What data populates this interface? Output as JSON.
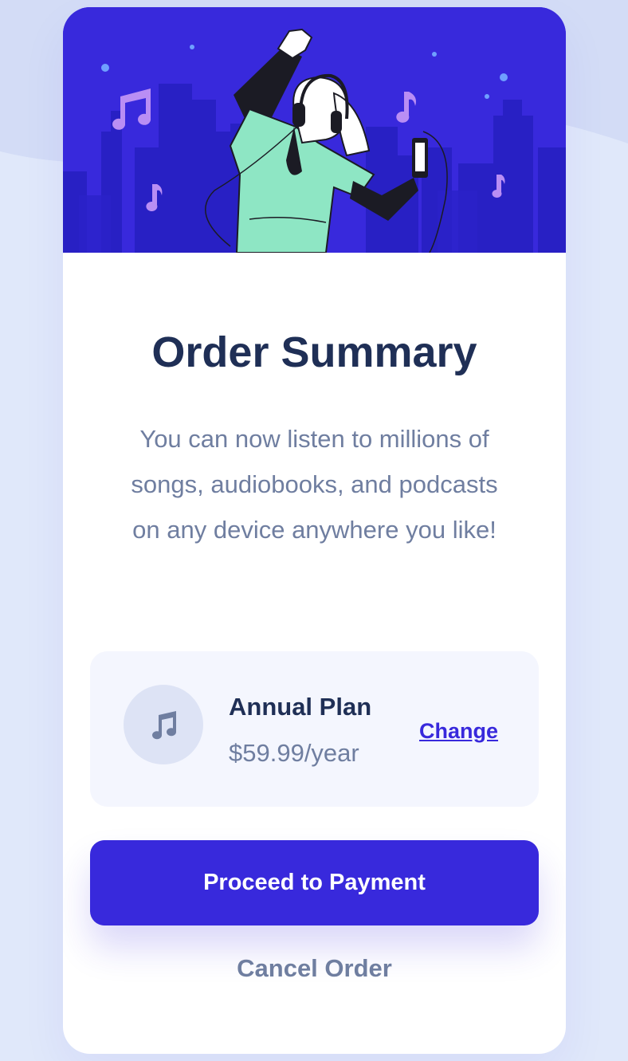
{
  "colors": {
    "page_background": "#e0e8fa",
    "accent": "#3829dc",
    "title": "#1f2f56",
    "muted_text": "#6f7ea0",
    "plan_background": "#f4f6fe"
  },
  "hero": {
    "illustration": "person-dancing-with-headphones-city-night"
  },
  "summary": {
    "title": "Order Summary",
    "description": "You can now listen to millions of songs, audiobooks, and podcasts on any device anywhere you like!"
  },
  "plan": {
    "icon": "music-note-icon",
    "name": "Annual Plan",
    "price": "$59.99/year",
    "change_label": "Change"
  },
  "actions": {
    "proceed_label": "Proceed to Payment",
    "cancel_label": "Cancel Order"
  }
}
